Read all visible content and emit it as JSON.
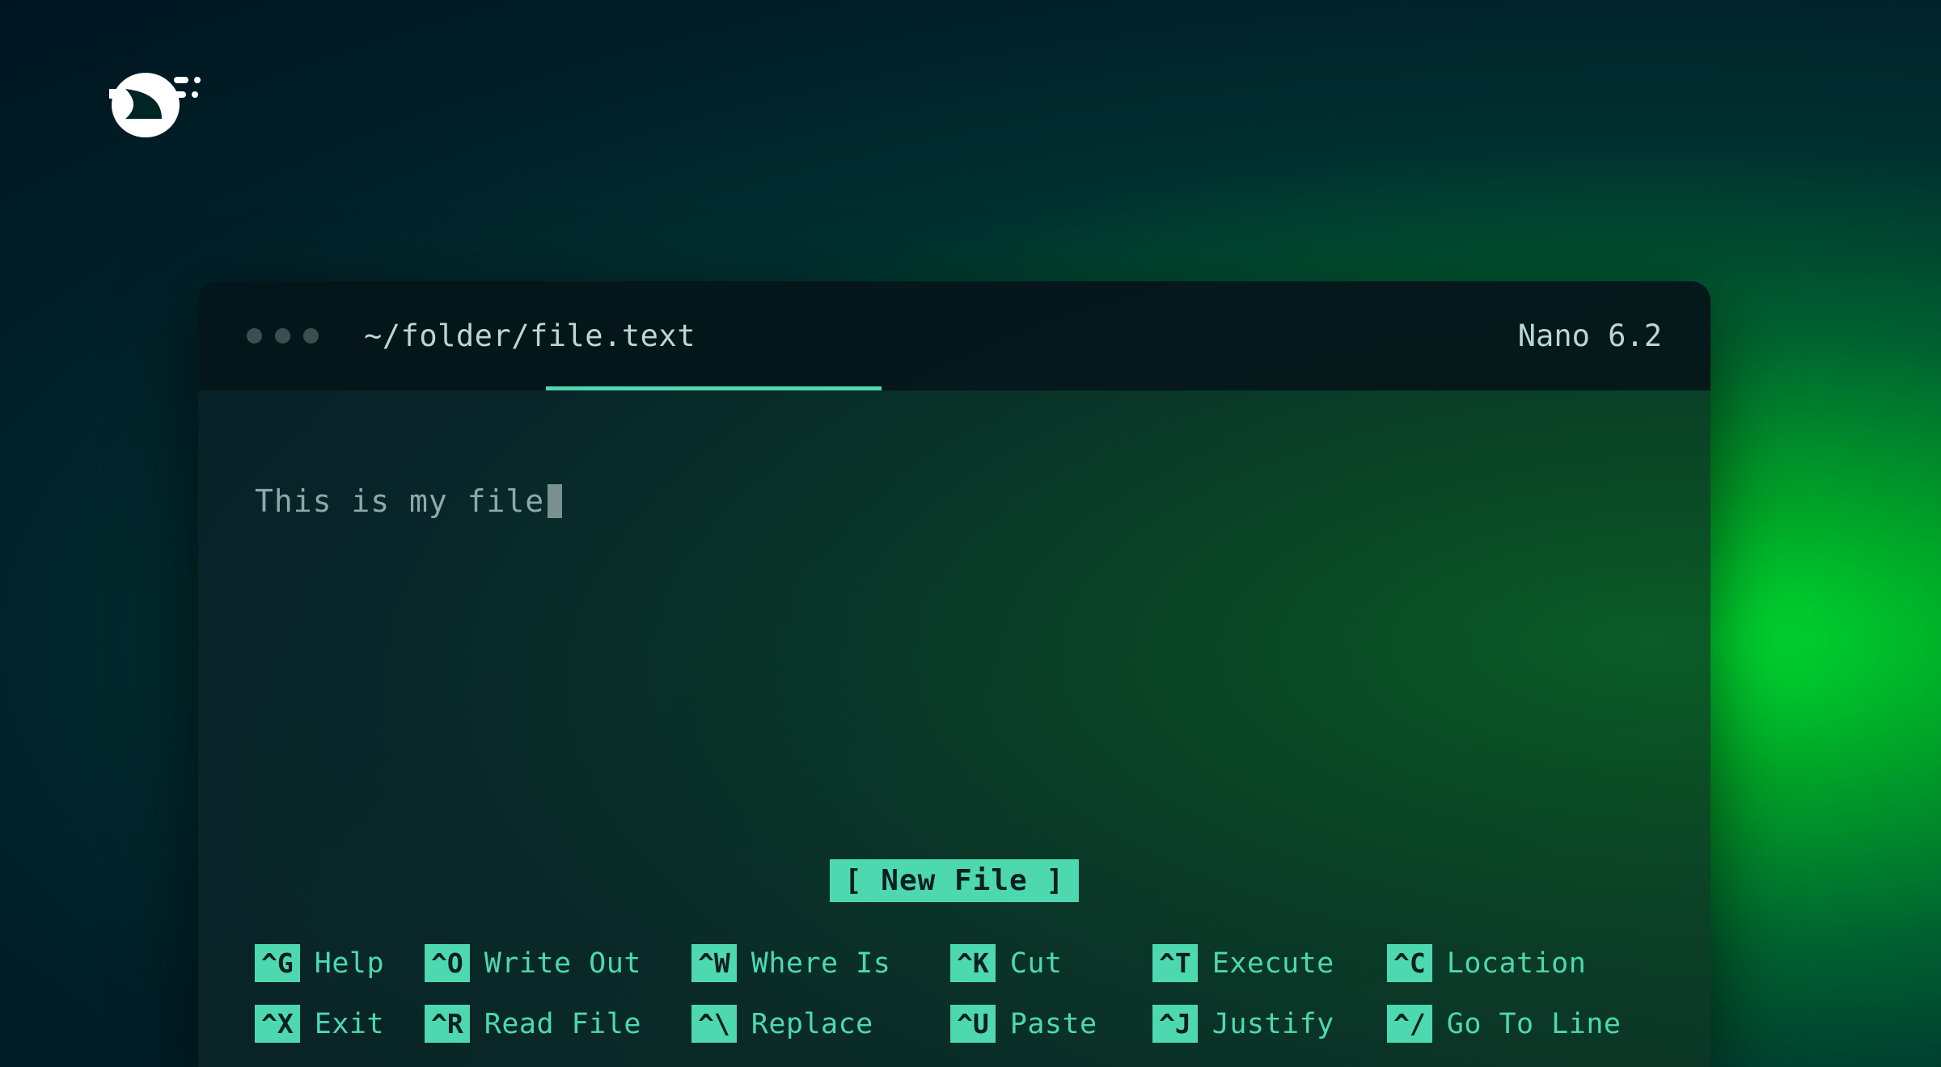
{
  "titlebar": {
    "filepath": "~/folder/file.text",
    "version": "Nano 6.2"
  },
  "editor": {
    "content": "This is my file",
    "status": "[ New File ]"
  },
  "shortcuts": [
    {
      "key": "^G",
      "label": "Help"
    },
    {
      "key": "^O",
      "label": "Write Out"
    },
    {
      "key": "^W",
      "label": "Where Is"
    },
    {
      "key": "^K",
      "label": "Cut"
    },
    {
      "key": "^T",
      "label": "Execute"
    },
    {
      "key": "^C",
      "label": "Location"
    },
    {
      "key": "^X",
      "label": "Exit"
    },
    {
      "key": "^R",
      "label": "Read File"
    },
    {
      "key": "^\\",
      "label": "Replace"
    },
    {
      "key": "^U",
      "label": "Paste"
    },
    {
      "key": "^J",
      "label": "Justify"
    },
    {
      "key": "^/",
      "label": "Go To Line"
    }
  ]
}
